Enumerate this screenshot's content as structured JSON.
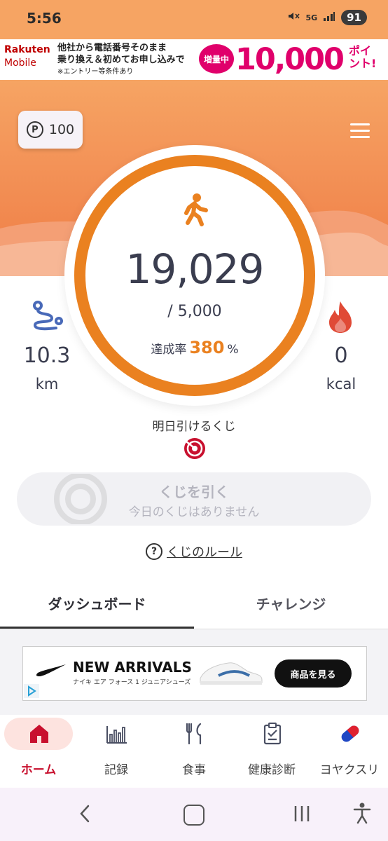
{
  "status_bar": {
    "time": "5:56",
    "signal": "5G",
    "battery": "91"
  },
  "ad_banner": {
    "brand_line1": "Rakuten",
    "brand_line2": "Mobile",
    "line1": "他社から電話番号そのまま",
    "line2": "乗り換え＆初めてお申し込みで",
    "note": "※エントリー等条件あり",
    "badge": "増量中",
    "amount": "10,000",
    "point_line1": "ポイ",
    "point_line2": "ント!"
  },
  "header": {
    "points_symbol": "P",
    "points": "100"
  },
  "ring": {
    "steps": "19,029",
    "goal": "/ 5,000",
    "rate_label": "達成率",
    "rate_value": "380",
    "rate_unit": "%"
  },
  "distance": {
    "value": "10.3",
    "unit": "km"
  },
  "calories": {
    "value": "0",
    "unit": "kcal"
  },
  "lottery": {
    "tomorrow_label": "明日引けるくじ",
    "button_title": "くじを引く",
    "button_sub": "今日のくじはありません",
    "rules_link": "くじのルール"
  },
  "tabs": [
    {
      "label": "ダッシュボード",
      "active": true
    },
    {
      "label": "チャレンジ",
      "active": false
    }
  ],
  "promo_ad": {
    "headline": "NEW ARRIVALS",
    "subline": "ナイキ エア フォース 1 ジュニアシューズ",
    "cta": "商品を見る"
  },
  "bottom_nav": [
    {
      "label": "ホーム",
      "icon": "home-icon",
      "active": true
    },
    {
      "label": "記録",
      "icon": "bar-chart-icon",
      "active": false
    },
    {
      "label": "食事",
      "icon": "fork-knife-icon",
      "active": false
    },
    {
      "label": "健康診断",
      "icon": "clipboard-check-icon",
      "active": false
    },
    {
      "label": "ヨヤクスリ",
      "icon": "capsule-icon",
      "active": false
    }
  ],
  "colors": {
    "accent": "#ea8120",
    "header": "#f39257",
    "nav_active": "#c8102e",
    "lottery_red": "#c8102e"
  }
}
